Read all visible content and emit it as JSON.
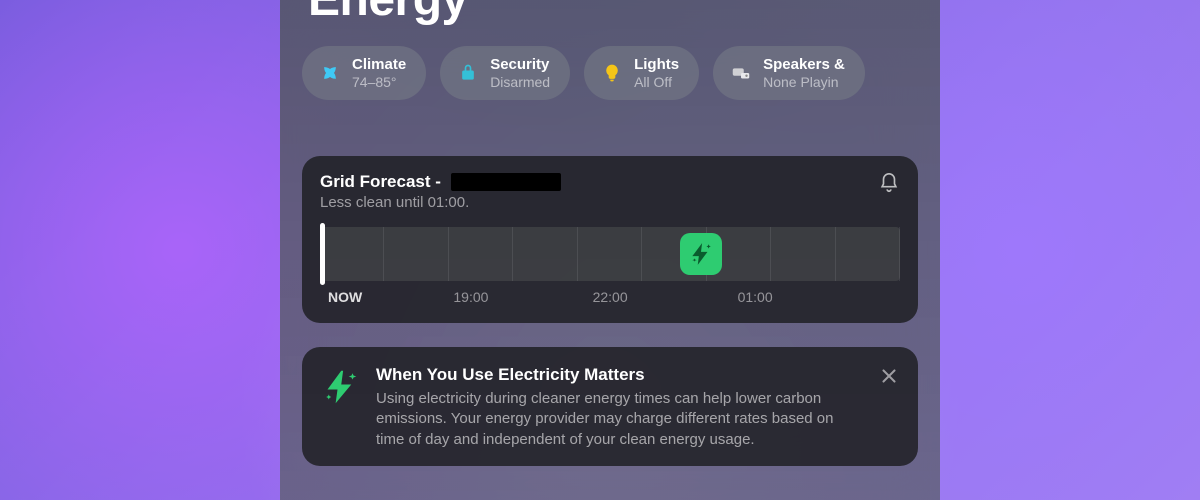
{
  "page": {
    "title": "Energy"
  },
  "status": {
    "climate": {
      "label": "Climate",
      "value": "74–85°"
    },
    "security": {
      "label": "Security",
      "value": "Disarmed"
    },
    "lights": {
      "label": "Lights",
      "value": "All Off"
    },
    "speakers": {
      "label": "Speakers &",
      "value": "None Playin"
    }
  },
  "forecast": {
    "title_prefix": "Grid Forecast - ",
    "subtitle": "Less clean until 01:00.",
    "labels": {
      "now": "NOW",
      "t1": "19:00",
      "t2": "22:00",
      "t3": "01:00"
    },
    "clean_marker_at": "01:00"
  },
  "info": {
    "title": "When You Use Electricity Matters",
    "body": "Using electricity during cleaner energy times can help lower carbon emissions. Your energy provider may charge different rates based on time of day and independent of your clean energy usage."
  },
  "colors": {
    "accent_green": "#2ecc71"
  }
}
